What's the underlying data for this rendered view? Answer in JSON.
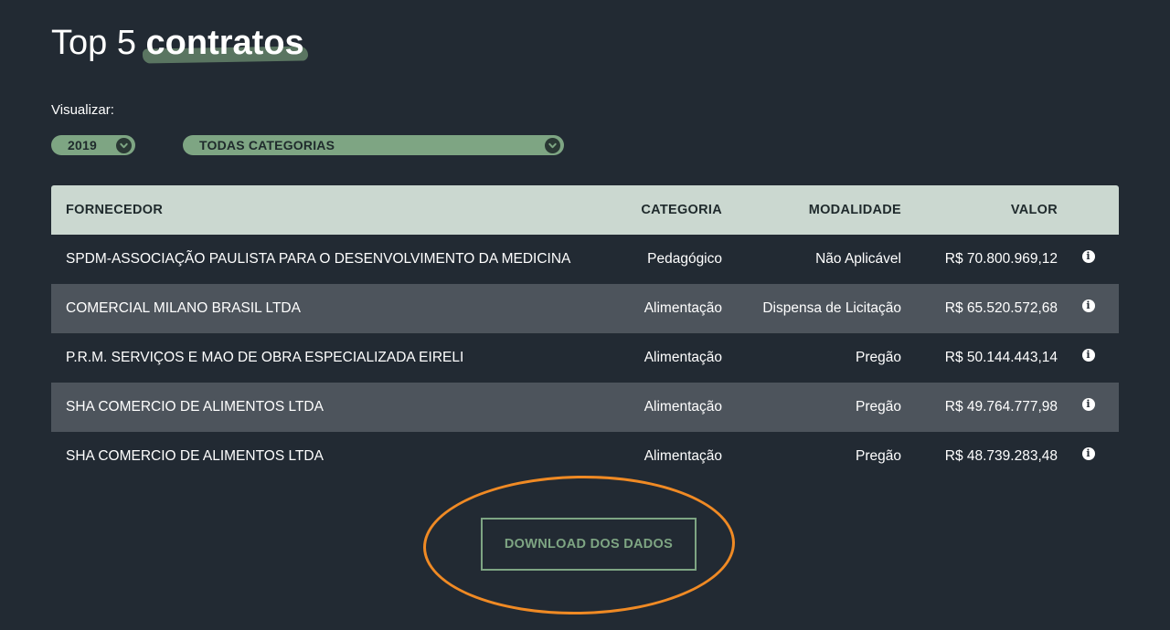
{
  "title": {
    "prefix": "Top 5",
    "highlight": "contratos"
  },
  "filters": {
    "label": "Visualizar:",
    "year": "2019",
    "category": "TODAS CATEGORIAS"
  },
  "table": {
    "headers": {
      "fornecedor": "FORNECEDOR",
      "categoria": "CATEGORIA",
      "modalidade": "MODALIDADE",
      "valor": "VALOR"
    },
    "rows": [
      {
        "fornecedor": "SPDM-ASSOCIAÇÃO PAULISTA PARA O DESENVOLVIMENTO DA MEDICINA",
        "categoria": "Pedagógico",
        "modalidade": "Não Aplicável",
        "valor": "R$ 70.800.969,12"
      },
      {
        "fornecedor": "COMERCIAL MILANO BRASIL LTDA",
        "categoria": "Alimentação",
        "modalidade": "Dispensa de Licitação",
        "valor": "R$ 65.520.572,68"
      },
      {
        "fornecedor": "P.R.M. SERVIÇOS E MAO DE OBRA ESPECIALIZADA EIRELI",
        "categoria": "Alimentação",
        "modalidade": "Pregão",
        "valor": "R$ 50.144.443,14"
      },
      {
        "fornecedor": "SHA COMERCIO DE ALIMENTOS LTDA",
        "categoria": "Alimentação",
        "modalidade": "Pregão",
        "valor": "R$ 49.764.777,98"
      },
      {
        "fornecedor": "SHA COMERCIO DE ALIMENTOS LTDA",
        "categoria": "Alimentação",
        "modalidade": "Pregão",
        "valor": "R$ 48.739.283,48"
      }
    ],
    "info_glyph": "i"
  },
  "download_label": "DOWNLOAD DOS DADOS",
  "colors": {
    "background": "#222a33",
    "accent": "#7ea583",
    "header_bg": "#cbd8d0",
    "alt_row": "#4d545c",
    "annotation": "#f08a24"
  }
}
